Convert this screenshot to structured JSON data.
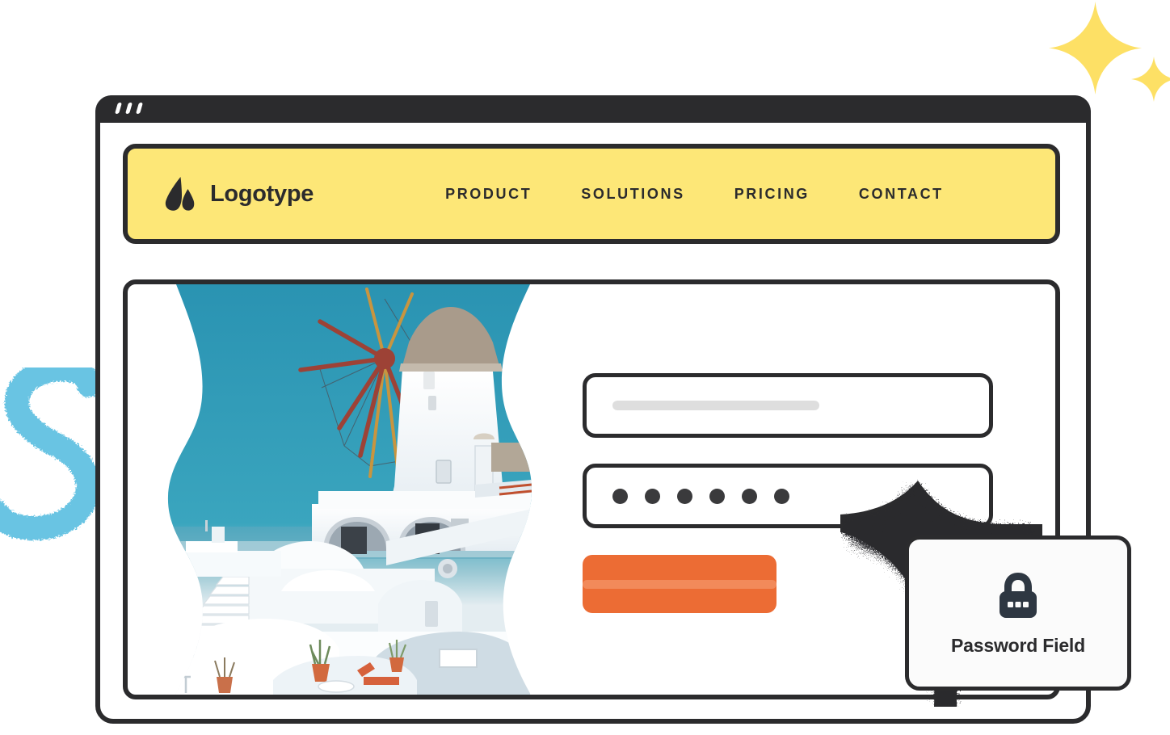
{
  "window": {
    "titlebar_dots": [
      "dot-1",
      "dot-2",
      "dot-3"
    ],
    "frame_color": "#2B2B2D"
  },
  "nav": {
    "brand": {
      "name": "Logotype",
      "logo_icon": "triangle-leaf-logo-icon"
    },
    "background_color": "#FDE777",
    "links": [
      {
        "label": "PRODUCT"
      },
      {
        "label": "SOLUTIONS"
      },
      {
        "label": "PRICING"
      },
      {
        "label": "CONTACT"
      }
    ]
  },
  "hero": {
    "image_description": "Santorini whitewashed village with thatched windmill against a teal sky",
    "sky_color": "#2E96B4",
    "mask": "wavy-edges"
  },
  "form": {
    "username_field": {
      "placeholder_bar": true,
      "value": ""
    },
    "password_field": {
      "masked_dots": 6,
      "value": "••••••"
    },
    "submit_button": {
      "label": "",
      "color": "#EC6C34",
      "label_bar": true
    }
  },
  "callout": {
    "icon": "padlock-icon",
    "label": "Password Field",
    "border_color": "#2B2B2D"
  },
  "decorations": {
    "sparkles": [
      {
        "name": "sparkle-large",
        "color": "#FDE065"
      },
      {
        "name": "sparkle-small",
        "color": "#FDE065"
      }
    ],
    "squiggle": {
      "name": "blue-squiggle",
      "color": "#69C4E3"
    },
    "dissolve": {
      "name": "pixel-dissolve",
      "color": "#2B2B2D"
    }
  }
}
